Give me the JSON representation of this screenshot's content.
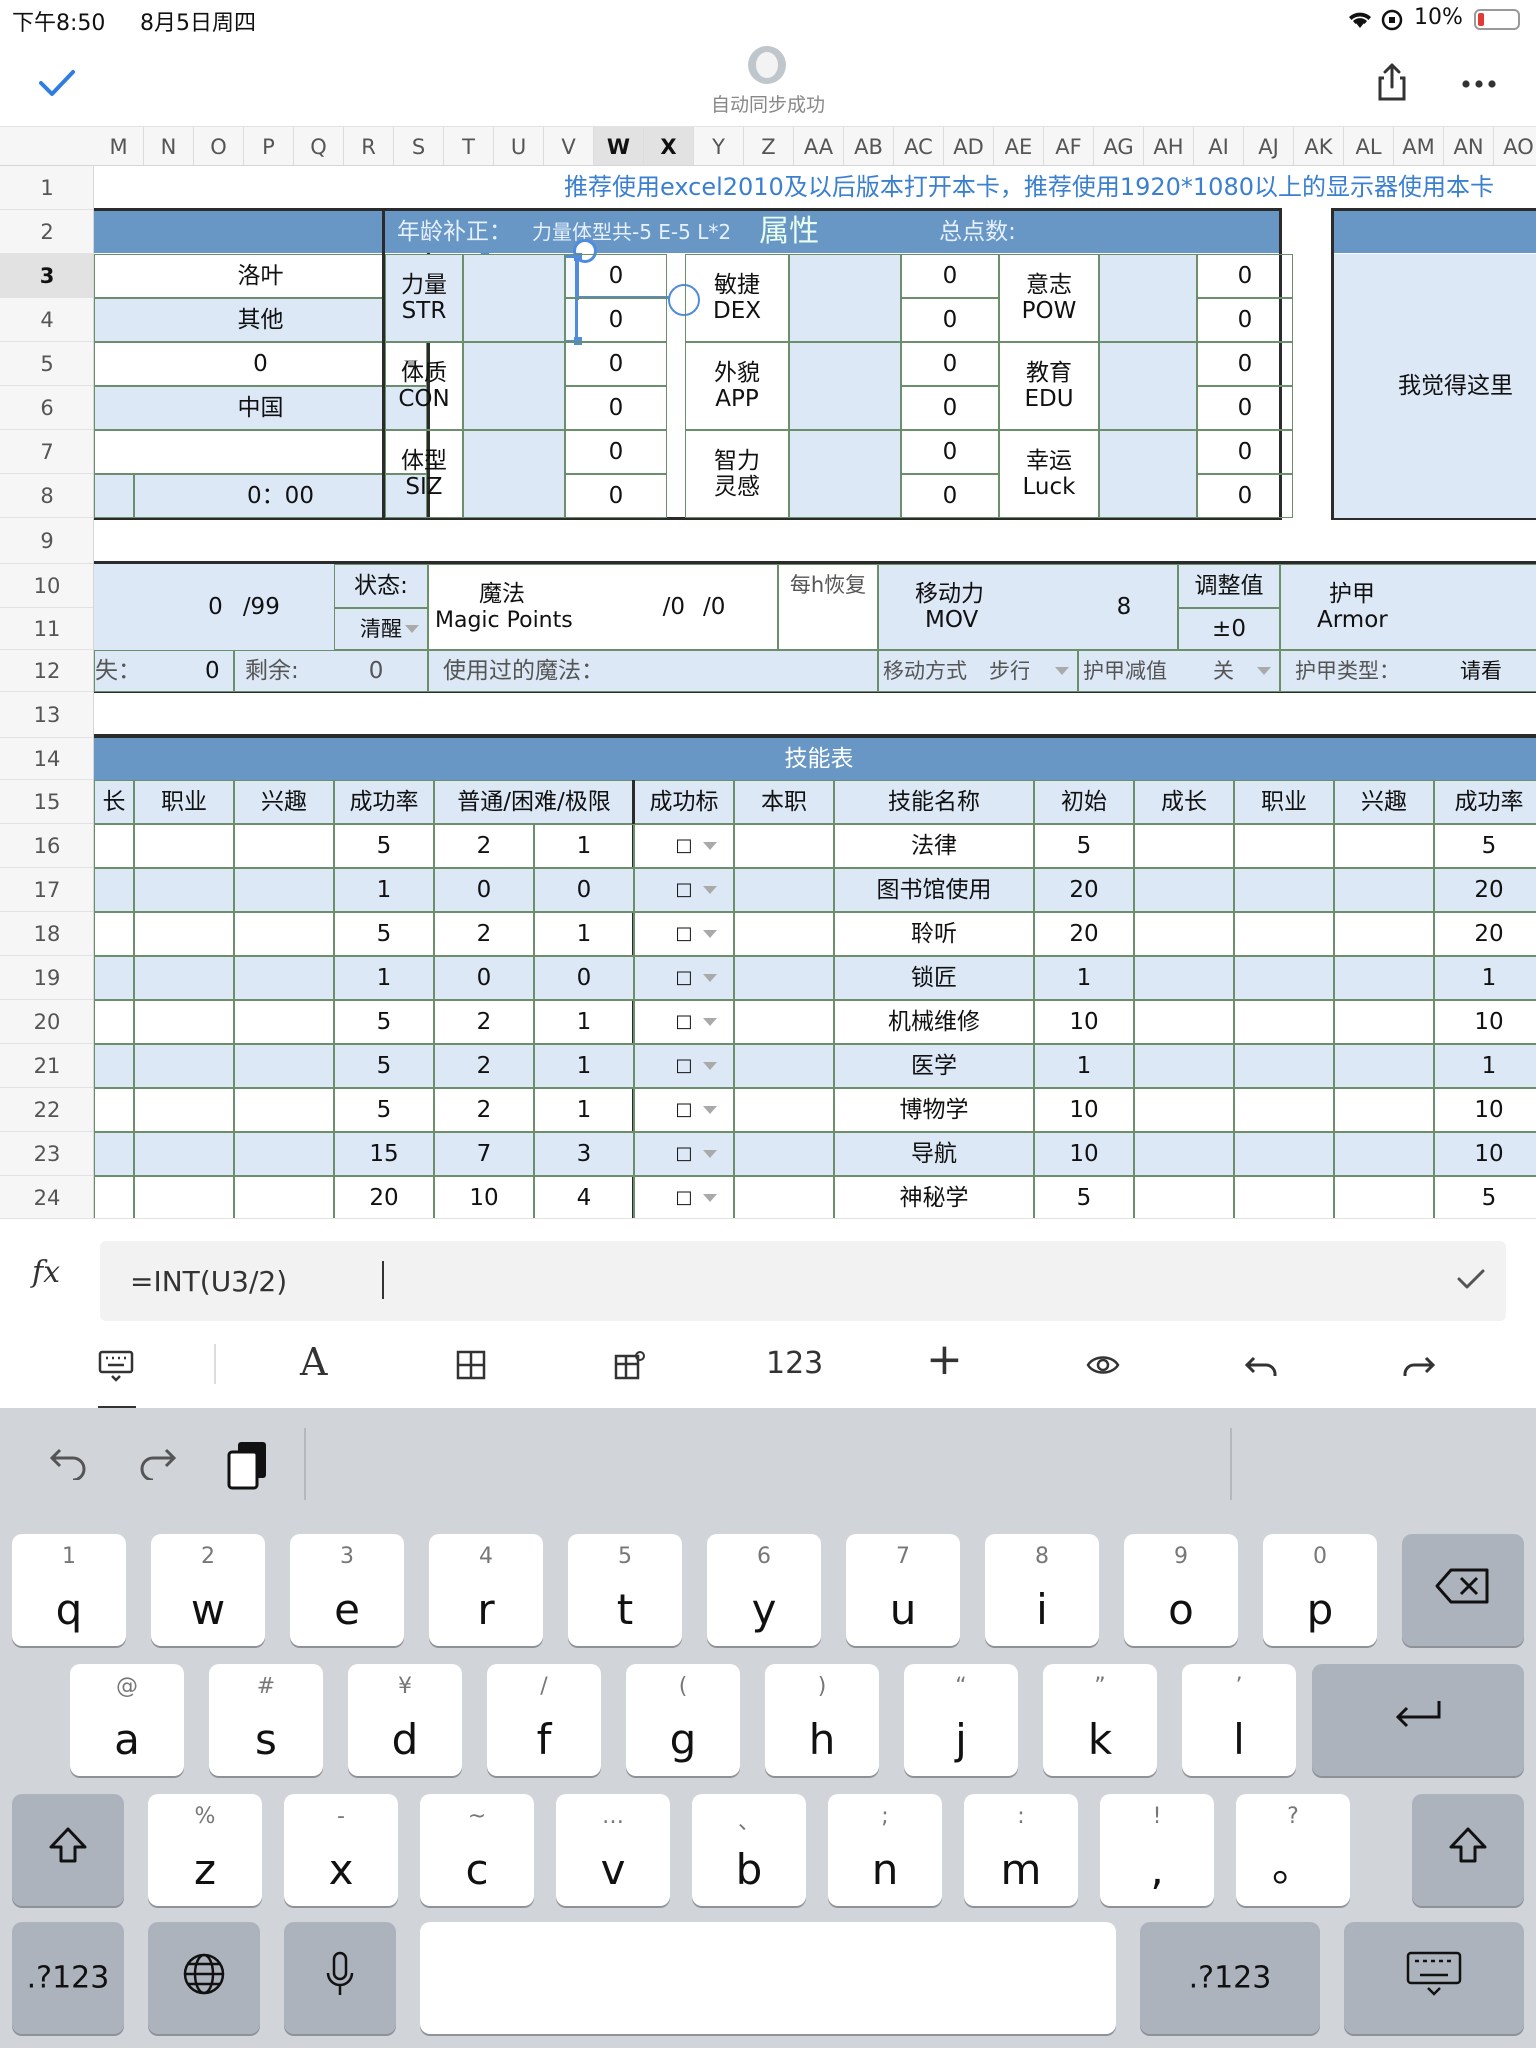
{
  "status_bar": {
    "time": "下午8:50",
    "date": "8月5日周四",
    "battery": "10%"
  },
  "app_bar": {
    "sync_status": "自动同步成功"
  },
  "column_headers": [
    "M",
    "N",
    "O",
    "P",
    "Q",
    "R",
    "S",
    "T",
    "U",
    "V",
    "W",
    "X",
    "Y",
    "Z",
    "AA",
    "AB",
    "AC",
    "AD",
    "AE",
    "AF",
    "AG",
    "AH",
    "AI",
    "AJ",
    "AK",
    "AL",
    "AM",
    "AN",
    "AO"
  ],
  "row_headers": [
    "1",
    "2",
    "3",
    "4",
    "5",
    "6",
    "7",
    "8",
    "9",
    "10",
    "11",
    "12",
    "13",
    "14",
    "15",
    "16",
    "17",
    "18",
    "19",
    "20",
    "21",
    "22",
    "23",
    "24"
  ],
  "sheet": {
    "banner": "推荐使用excel2010及以后版本打开本卡，推荐使用1920*1080以上的显示器使用本卡",
    "info": {
      "name": "洛叶",
      "other": "其他",
      "zero": "0",
      "country": "中国",
      "time": "0：00"
    },
    "attr_header": {
      "age_fix": "年龄补正：",
      "age_fix_note": "力量体型共-5 E-5 L*2",
      "title": "属性",
      "total": "总点数:"
    },
    "attributes": [
      {
        "zh": "力量",
        "en": "STR",
        "v1": "0",
        "v2": "0"
      },
      {
        "zh": "敏捷",
        "en": "DEX",
        "v1": "0",
        "v2": "0"
      },
      {
        "zh": "意志",
        "en": "POW",
        "v1": "0",
        "v2": "0"
      },
      {
        "zh": "体质",
        "en": "CON",
        "v1": "0",
        "v2": "0"
      },
      {
        "zh": "外貌",
        "en": "APP",
        "v1": "0",
        "v2": "0"
      },
      {
        "zh": "教育",
        "en": "EDU",
        "v1": "0",
        "v2": "0"
      },
      {
        "zh": "体型",
        "en": "SIZ",
        "v1": "0",
        "v2": "0"
      },
      {
        "zh": "智力",
        "en": "灵感",
        "v1": "0",
        "v2": "0"
      },
      {
        "zh": "幸运",
        "en": "Luck",
        "v1": "0",
        "v2": "0"
      }
    ],
    "side_note": "我觉得这里",
    "status_row": {
      "hp": "0",
      "hp_max": "/99",
      "status_label": "状态:",
      "status_value": "清醒",
      "magic_zh": "魔法",
      "magic_en": "Magic Points",
      "mp_cur": "/0",
      "mp_max": "/0",
      "per_hour": "每h恢复",
      "mov_zh": "移动力",
      "mov_en": "MOV",
      "mov_value": "8",
      "adj_label": "调整值",
      "adj_value": "±0",
      "armor_zh": "护甲",
      "armor_en": "Armor"
    },
    "row12": {
      "lost_label": "失：",
      "lost_value": "0",
      "remain_label": "剩余:",
      "remain_value": "0",
      "used_magic": "使用过的魔法：",
      "move_mode_label": "移动方式",
      "move_mode_value": "步行",
      "armor_reduce_label": "护甲减值",
      "armor_reduce_value": "关",
      "armor_type_label": "护甲类型：",
      "armor_type_value": "请看"
    },
    "skills_title": "技能表",
    "skill_headers": {
      "grow_cut": "长",
      "job": "职业",
      "interest": "兴趣",
      "rate": "成功率",
      "levels": "普通/困难/极限",
      "mark": "成功标",
      "own": "本职",
      "name": "技能名称",
      "init": "初始",
      "grow": "成长",
      "job2": "职业",
      "interest2": "兴趣",
      "rate2": "成功率"
    },
    "skills": [
      {
        "rate": "5",
        "hard": "2",
        "extreme": "1",
        "name": "法律",
        "init": "5",
        "total": "5"
      },
      {
        "rate": "1",
        "hard": "0",
        "extreme": "0",
        "name": "图书馆使用",
        "init": "20",
        "total": "20"
      },
      {
        "rate": "5",
        "hard": "2",
        "extreme": "1",
        "name": "聆听",
        "init": "20",
        "total": "20"
      },
      {
        "rate": "1",
        "hard": "0",
        "extreme": "0",
        "name": "锁匠",
        "init": "1",
        "total": "1"
      },
      {
        "rate": "5",
        "hard": "2",
        "extreme": "1",
        "name": "机械维修",
        "init": "10",
        "total": "10"
      },
      {
        "rate": "5",
        "hard": "2",
        "extreme": "1",
        "name": "医学",
        "init": "1",
        "total": "1"
      },
      {
        "rate": "5",
        "hard": "2",
        "extreme": "1",
        "name": "博物学",
        "init": "10",
        "total": "10"
      },
      {
        "rate": "15",
        "hard": "7",
        "extreme": "3",
        "name": "导航",
        "init": "10",
        "total": "10"
      },
      {
        "rate": "20",
        "hard": "10",
        "extreme": "4",
        "name": "神秘学",
        "init": "5",
        "total": "5"
      }
    ],
    "checkbox_glyph": "□"
  },
  "formula_bar": {
    "fx_label": "fx",
    "value": "=INT(U3/2)"
  },
  "toolbar": {
    "numbers_label": "123"
  },
  "keyboard": {
    "row1": [
      {
        "h": "1",
        "m": "q"
      },
      {
        "h": "2",
        "m": "w"
      },
      {
        "h": "3",
        "m": "e"
      },
      {
        "h": "4",
        "m": "r"
      },
      {
        "h": "5",
        "m": "t"
      },
      {
        "h": "6",
        "m": "y"
      },
      {
        "h": "7",
        "m": "u"
      },
      {
        "h": "8",
        "m": "i"
      },
      {
        "h": "9",
        "m": "o"
      },
      {
        "h": "0",
        "m": "p"
      }
    ],
    "row2": [
      {
        "h": "@",
        "m": "a"
      },
      {
        "h": "#",
        "m": "s"
      },
      {
        "h": "¥",
        "m": "d"
      },
      {
        "h": "/",
        "m": "f"
      },
      {
        "h": "(",
        "m": "g"
      },
      {
        "h": ")",
        "m": "h"
      },
      {
        "h": "“",
        "m": "j"
      },
      {
        "h": "”",
        "m": "k"
      },
      {
        "h": "’",
        "m": "l"
      }
    ],
    "row3": [
      {
        "h": "%",
        "m": "z"
      },
      {
        "h": "-",
        "m": "x"
      },
      {
        "h": "~",
        "m": "c"
      },
      {
        "h": "…",
        "m": "v"
      },
      {
        "h": "、",
        "m": "b"
      },
      {
        "h": ";",
        "m": "n"
      },
      {
        "h": ":",
        "m": "m"
      },
      {
        "h": "!",
        "m": ","
      },
      {
        "h": "?",
        "m": "。"
      }
    ],
    "numbers_key": ".?123"
  }
}
